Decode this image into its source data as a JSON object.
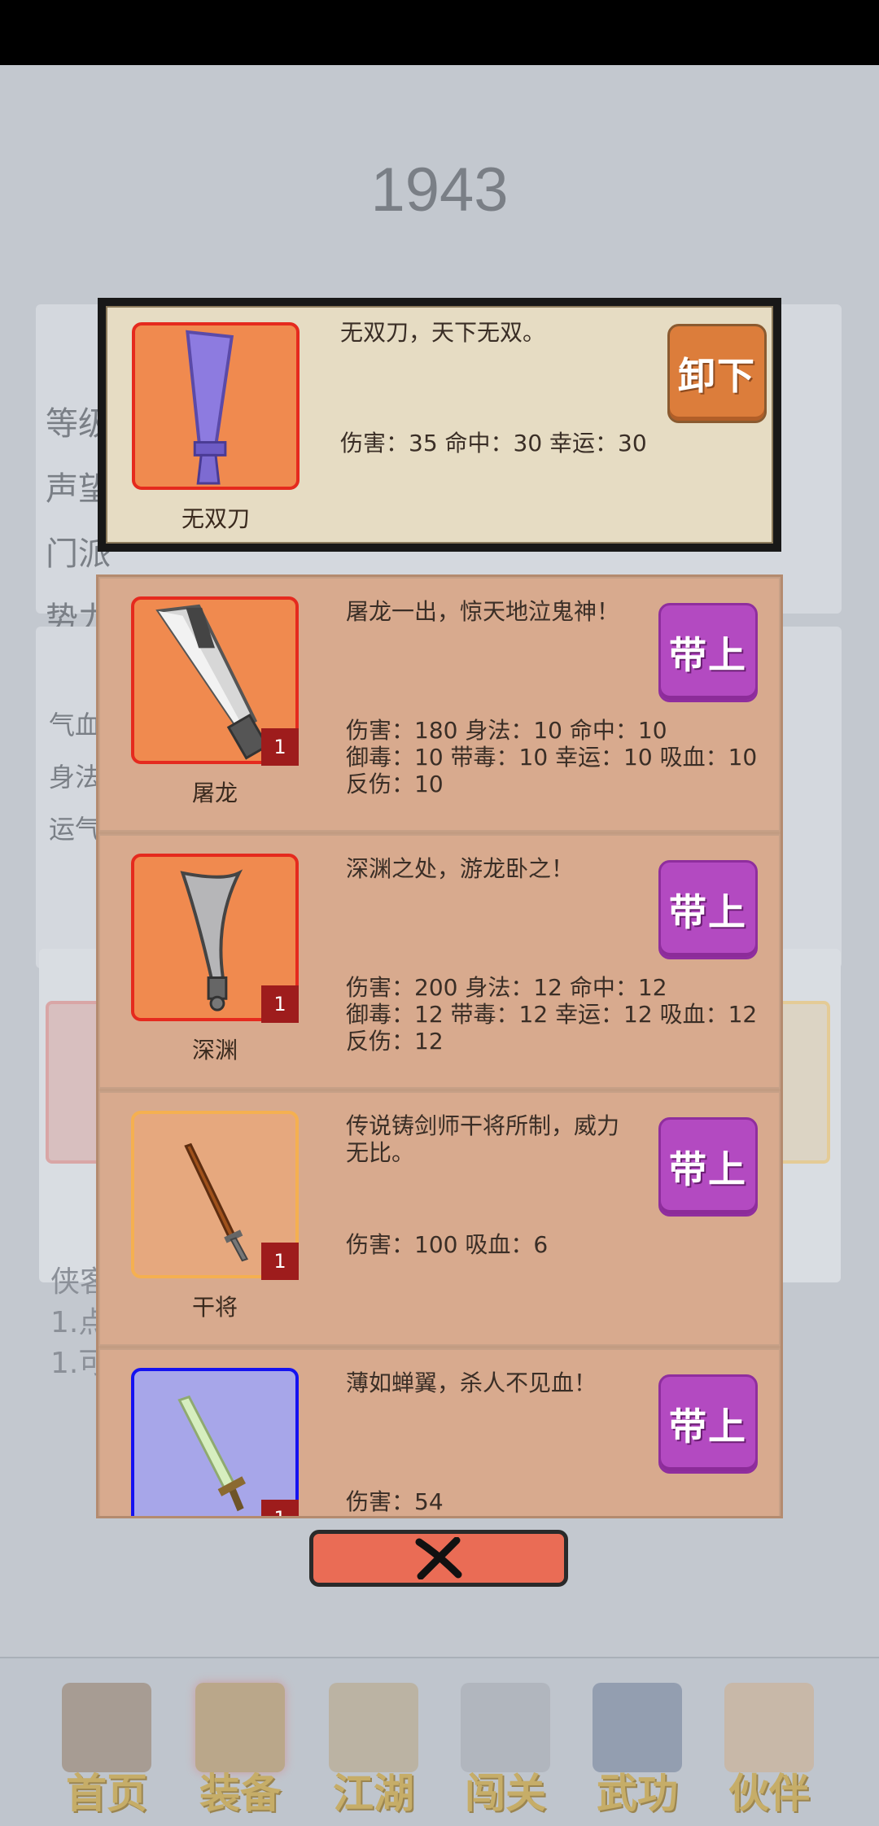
{
  "background": {
    "score": "1943",
    "stats_main": [
      "等级",
      "声望",
      "门派",
      "势力：正派"
    ],
    "stats_sub": [
      "气血",
      "身法",
      "运气"
    ],
    "notes": [
      "侠客",
      "1.点",
      "1.可"
    ]
  },
  "equipped": {
    "name": "无双刀",
    "desc": "无双刀，天下无双。",
    "stats": "伤害：35 命中：30 幸运：30",
    "button_label": "卸下"
  },
  "items": [
    {
      "name": "屠龙",
      "desc": "屠龙一出，惊天地泣鬼神！",
      "stats_lines": [
        "伤害：180 身法：10 命中：10",
        "御毒：10 带毒：10 幸运：10 吸血：10",
        "反伤：10"
      ],
      "count": "1",
      "button_label": "带上",
      "icon": "dragon-saber-icon"
    },
    {
      "name": "深渊",
      "desc": "深渊之处，游龙卧之！",
      "stats_lines": [
        "伤害：200 身法：12 命中：12",
        "御毒：12 带毒：12 幸运：12 吸血：12",
        "反伤：12"
      ],
      "count": "1",
      "button_label": "带上",
      "icon": "abyss-blade-icon"
    },
    {
      "name": "干将",
      "desc_lines": [
        "传说铸剑师干将所制，威力",
        "无比。"
      ],
      "stats_lines": [
        "伤害：100 吸血：6"
      ],
      "count": "1",
      "button_label": "带上",
      "icon": "ganjiang-sword-icon"
    },
    {
      "name": "",
      "desc": "薄如蝉翼，杀人不见血！",
      "stats_lines": [
        "伤害：54"
      ],
      "count": "1",
      "button_label": "带上",
      "icon": "jade-sword-icon"
    }
  ],
  "nav": [
    "首页",
    "装备",
    "江湖",
    "闯关",
    "武功",
    "伙伴"
  ],
  "close_icon": "close-x-icon"
}
